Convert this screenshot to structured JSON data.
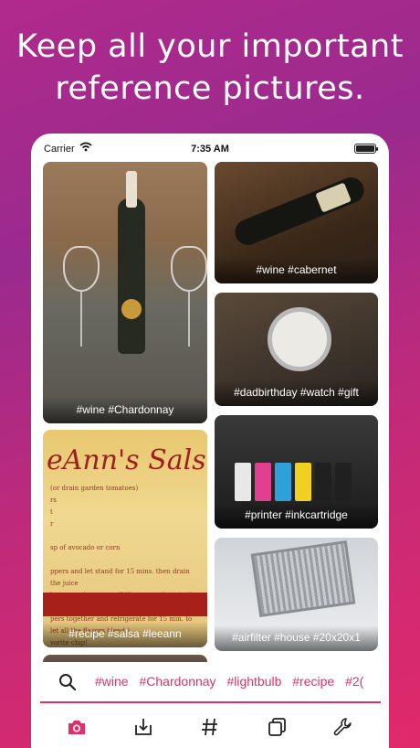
{
  "headline": {
    "line1": "Keep all  your important",
    "line2": "reference pictures."
  },
  "status_bar": {
    "carrier": "Carrier",
    "time": "7:35 AM"
  },
  "photos": [
    {
      "caption": "#wine #Chardonnay"
    },
    {
      "caption": "#recipe #salsa #leeann",
      "title": "eAnn's Sals",
      "text": "(or drain garden tomatoes)\nrs\nt\nr\n\nsp of avocado or corn\n\nppers and let stand for 15 mins. then drain the juice\nlantro, and peppers. (I like to put them in the blender and g\npers together and refrigerate for 15 min. to let all the flavors blend.)\nvorite chip!"
    },
    {
      "caption": ""
    },
    {
      "caption": "#wine #cabernet"
    },
    {
      "caption": "#dadbirthday #watch #gift"
    },
    {
      "caption": "#printer #inkcartridge"
    },
    {
      "caption": "#airfilter #house #20x20x1"
    }
  ],
  "tag_bar": {
    "tags": [
      "#wine",
      "#Chardonnay",
      "#lightbulb",
      "#recipe",
      "#2("
    ]
  },
  "tab_bar": {
    "items": [
      "camera",
      "import",
      "hashtag",
      "collections",
      "settings"
    ],
    "active": "camera"
  },
  "colors": {
    "accent": "#e0306a",
    "gradient_top": "#9a2a8e",
    "gradient_bottom": "#e0296a"
  }
}
